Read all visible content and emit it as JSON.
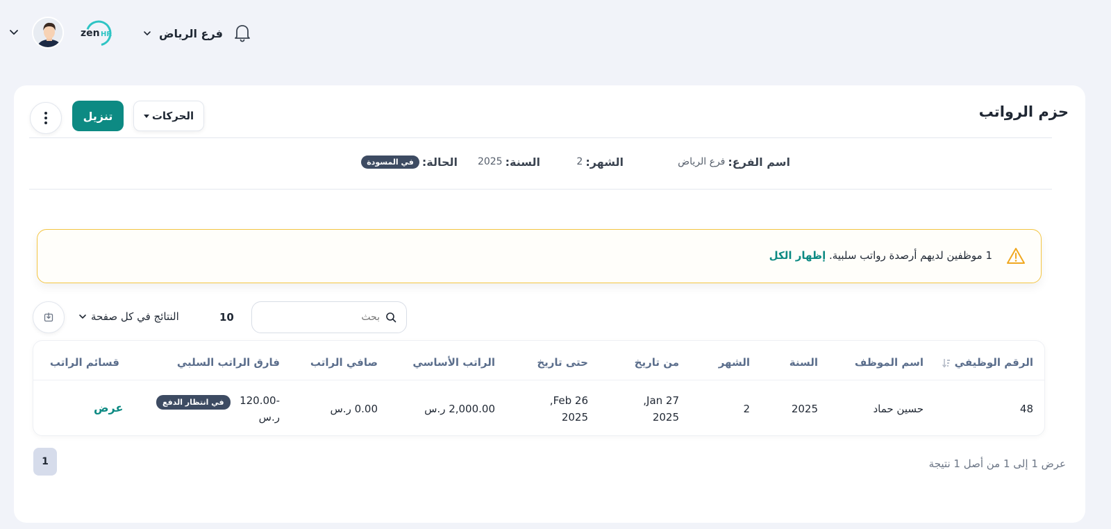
{
  "header": {
    "logo_text": "zenHR",
    "branch": "فرع الرياض",
    "icons": [
      "chevron-down-icon",
      "avatar",
      "notification-bell-icon"
    ]
  },
  "card": {
    "title": "حزم الرواتب",
    "actions_label": "الحركات",
    "download_label": "تنزيل"
  },
  "info": {
    "branch_key": "اسم الفرع:",
    "branch_val": "فرع الرياض",
    "month_key": "الشهر:",
    "month_val": "2",
    "year_key": "السنة:",
    "year_val": "2025",
    "status_key": "الحالة:",
    "status_val": "في المسودة"
  },
  "alert": {
    "message": "1 موظفين لديهم أرصدة رواتب سلبية.",
    "link": "إظهار الكل"
  },
  "controls": {
    "search_placeholder": "بحث",
    "per_page_value": "10",
    "per_page_label": "النتائج في كل صفحة"
  },
  "table": {
    "headers": [
      "الرقم الوظيفي",
      "اسم الموظف",
      "السنة",
      "الشهر",
      "من تاريخ",
      "حتى تاريخ",
      "الراتب الأساسي",
      "صافي الراتب",
      "فارق الراتب السلبي",
      "قسائم الراتب"
    ],
    "rows": [
      {
        "emp_no": "48",
        "name": "حسين حماد",
        "year": "2025",
        "month": "2",
        "from_1": "Jan 27,",
        "from_2": "2025",
        "to_1": "Feb 26,",
        "to_2": "2025",
        "basic": "2,000.00 ر.س",
        "net": "0.00 ر.س",
        "neg_1": "-120.00",
        "neg_2": "ر.س",
        "neg_badge": "في انتظار الدفع",
        "view": "عرض"
      }
    ]
  },
  "pagination": {
    "current_page": "1",
    "results_text": "عرض 1 إلى 1 من أصل 1 نتيجة"
  },
  "colors": {
    "accent": "#0d8a83",
    "badge": "#3d4b62",
    "warning": "#f4c542",
    "background": "#f1f3f9"
  }
}
